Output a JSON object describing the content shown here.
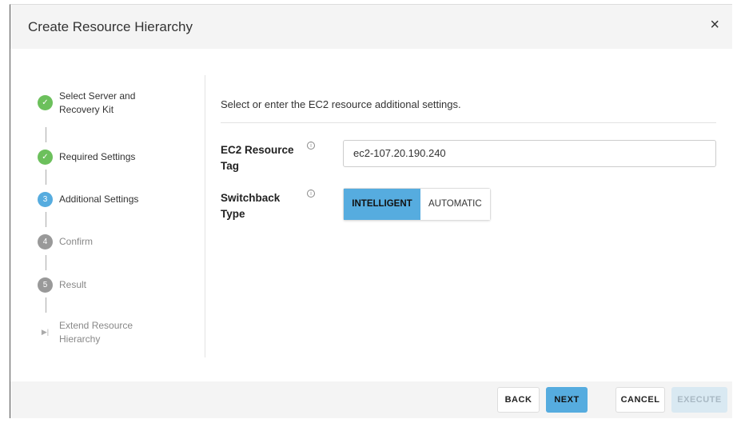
{
  "dialog": {
    "title": "Create Resource Hierarchy",
    "close_icon": "×"
  },
  "steps": [
    {
      "label": "Select Server and Recovery Kit",
      "status": "done",
      "marker": "✓"
    },
    {
      "label": "Required Settings",
      "status": "done",
      "marker": "✓"
    },
    {
      "label": "Additional Settings",
      "status": "active",
      "marker": "3"
    },
    {
      "label": "Confirm",
      "status": "pending",
      "marker": "4"
    },
    {
      "label": "Result",
      "status": "pending",
      "marker": "5"
    },
    {
      "label": "Extend Resource Hierarchy",
      "status": "pending",
      "marker": "▶|"
    }
  ],
  "main": {
    "intro": "Select or enter the EC2 resource additional settings.",
    "fields": {
      "tag": {
        "label": "EC2 Resource Tag",
        "value": "ec2-107.20.190.240"
      },
      "switchback": {
        "label": "Switchback Type",
        "options": [
          "INTELLIGENT",
          "AUTOMATIC"
        ],
        "selected": "INTELLIGENT"
      }
    },
    "info_icon": "i"
  },
  "footer": {
    "back": "BACK",
    "next": "NEXT",
    "cancel": "CANCEL",
    "execute": "EXECUTE"
  },
  "colors": {
    "accent": "#56acdf",
    "done": "#6cc05c",
    "pending": "#999999"
  }
}
